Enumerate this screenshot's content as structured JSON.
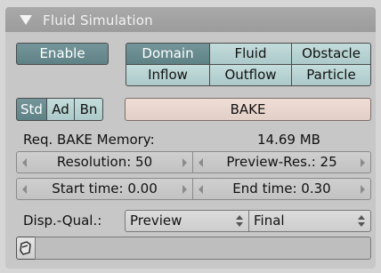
{
  "panel": {
    "title": "Fluid Simulation",
    "collapse_icon": "triangle-down-icon"
  },
  "enable_label": "Enable",
  "type_buttons": {
    "domain": "Domain",
    "fluid": "Fluid",
    "obstacle": "Obstacle",
    "inflow": "Inflow",
    "outflow": "Outflow",
    "particle": "Particle"
  },
  "settings_tabs": {
    "std": "Std",
    "ad": "Ad",
    "bn": "Bn"
  },
  "bake_label": "BAKE",
  "memory": {
    "label": "Req. BAKE Memory:",
    "value": "14.69 MB"
  },
  "fields": {
    "resolution": "Resolution: 50",
    "preview_res": "Preview-Res.: 25",
    "start_time": "Start time: 0.00",
    "end_time": "End time: 0.30"
  },
  "display_quality": {
    "label": "Disp.-Qual.:",
    "viewport_value": "Preview",
    "render_value": "Final"
  },
  "path_field": {
    "icon": "folder-browse-icon",
    "value": ""
  },
  "colors": {
    "header": "#a3a3a3",
    "selected_teal": "#6a8c90",
    "light_teal": "#b8d3d3",
    "bake_peach": "#e9d6ce",
    "panel_bg": "#c7c7c7"
  }
}
